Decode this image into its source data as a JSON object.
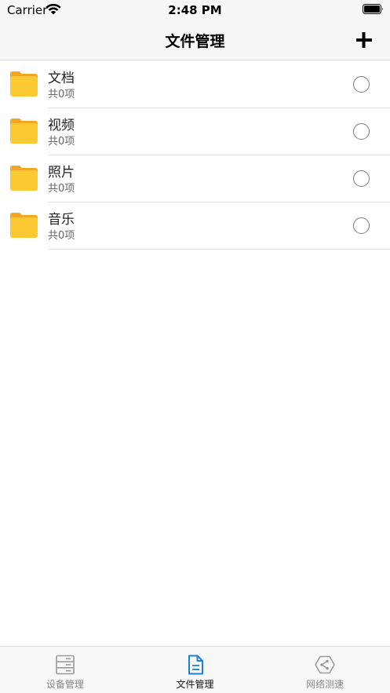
{
  "status_bar": {
    "carrier": "Carrier",
    "time": "2:48 PM"
  },
  "nav": {
    "title": "文件管理",
    "add_icon": "plus-icon"
  },
  "folders": [
    {
      "name": "文档",
      "count": "共0项"
    },
    {
      "name": "视频",
      "count": "共0项"
    },
    {
      "name": "照片",
      "count": "共0项"
    },
    {
      "name": "音乐",
      "count": "共0项"
    }
  ],
  "tabs": [
    {
      "label": "设备管理",
      "icon": "server-icon",
      "active": false
    },
    {
      "label": "文件管理",
      "icon": "document-icon",
      "active": true
    },
    {
      "label": "网络测速",
      "icon": "network-speed-icon",
      "active": false
    }
  ],
  "colors": {
    "accent": "#1a7fe0",
    "folder_front": "#fcc933",
    "folder_back": "#f5a623",
    "inactive": "#888888"
  }
}
